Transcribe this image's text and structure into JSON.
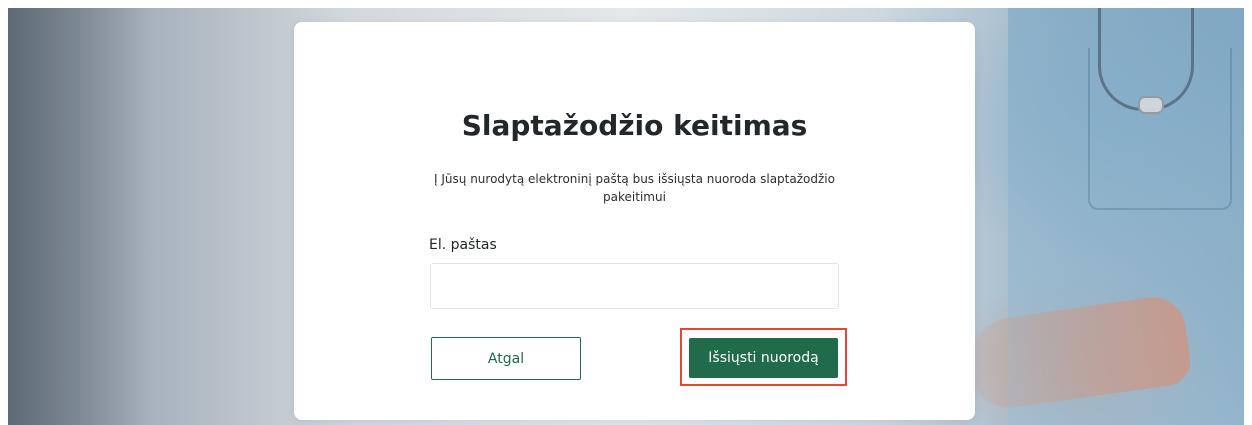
{
  "dialog": {
    "title": "Slaptažodžio keitimas",
    "description": "Į Jūsų nurodytą elektroninį paštą bus išsiųsta nuoroda slaptažodžio pakeitimui",
    "email_label": "El. paštas",
    "email_value": "",
    "email_placeholder": "",
    "back_label": "Atgal",
    "send_label": "Išsiųsti nuorodą"
  },
  "colors": {
    "primary": "#1f6b4a",
    "highlight": "#e0483a",
    "title": "#22272b"
  }
}
